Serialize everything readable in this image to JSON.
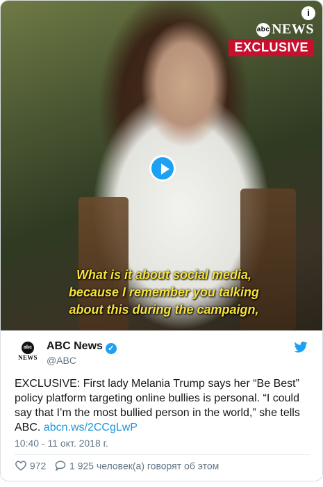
{
  "media": {
    "network_logo": "NEWS",
    "network_logo_mark": "abc",
    "exclusive_label": "EXCLUSIVE",
    "info_icon": "i",
    "caption_lines": [
      "What is it about social media,",
      "because I remember you talking",
      "about this during the campaign,"
    ]
  },
  "author": {
    "avatar_text_top": "abc",
    "avatar_text_bottom": "NEWS",
    "name": "ABC News",
    "handle": "@ABC"
  },
  "tweet": {
    "text": "EXCLUSIVE: First lady Melania Trump says her “Be Best” policy platform targeting online bullies is personal. “I could say that I’m the most bullied person in the world,” she tells ABC. ",
    "link": "abcn.ws/2CCgLwP",
    "timestamp": "10:40 - 11 окт. 2018 г."
  },
  "stats": {
    "likes": "972",
    "replies_text": "1 925 человек(а) говорят об этом"
  },
  "colors": {
    "accent": "#1da1f2",
    "exclusive_red": "#c8102e",
    "caption_yellow": "#f6e23a"
  },
  "icons": {
    "verified": "verified-badge-icon",
    "bird": "twitter-bird-icon",
    "play": "play-icon",
    "heart": "heart-icon",
    "reply": "reply-bubble-icon"
  }
}
